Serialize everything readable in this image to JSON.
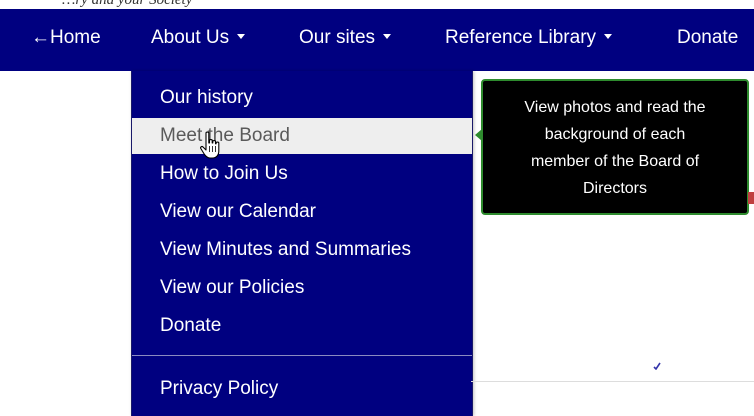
{
  "top_fragment": "…ry and your Society",
  "nav": {
    "home": "←Home",
    "about": "About Us",
    "sites": "Our sites",
    "reference": "Reference Library",
    "donate": "Donate"
  },
  "dropdown": {
    "items": [
      {
        "label": "Our history"
      },
      {
        "label": "Meet the Board"
      },
      {
        "label": "How to Join Us"
      },
      {
        "label": "View our Calendar"
      },
      {
        "label": "View Minutes and Summaries"
      },
      {
        "label": "View our Policies"
      },
      {
        "label": "Donate"
      }
    ],
    "after_divider": [
      {
        "label": "Privacy Policy"
      }
    ]
  },
  "tooltip": {
    "lines": [
      "View photos and read the",
      "background of each",
      "member of the Board of",
      "Directors"
    ]
  },
  "icons": {
    "cursor": "hand-pointer-icon",
    "caret": "caret-down-icon"
  },
  "colors": {
    "nav_bg": "#000080",
    "highlight_bg": "#eeeeee",
    "tooltip_bg": "#000000",
    "tooltip_border": "#2e8b2e"
  }
}
